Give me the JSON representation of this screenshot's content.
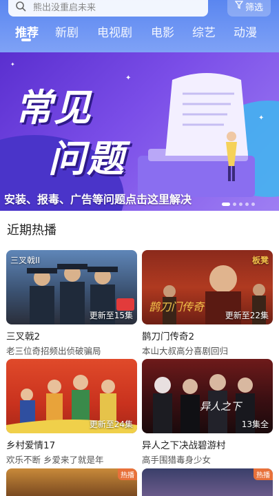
{
  "search": {
    "placeholder": "熊出没重启未来",
    "filter_label": "筛选"
  },
  "tabs": [
    {
      "label": "推荐",
      "active": true
    },
    {
      "label": "新剧",
      "active": false
    },
    {
      "label": "电视剧",
      "active": false
    },
    {
      "label": "电影",
      "active": false
    },
    {
      "label": "综艺",
      "active": false
    },
    {
      "label": "动漫",
      "active": false
    }
  ],
  "banner": {
    "title_line1": "常见",
    "title_line2": "问题",
    "caption": "安装、报毒、广告等问题点击这里解决"
  },
  "section": {
    "title": "近期热播"
  },
  "cards": [
    {
      "title": "三叉戟2",
      "subtitle": "老三位奇招频出侦破骗局",
      "badge": "更新至15集",
      "corner_text": "三叉戟II"
    },
    {
      "title": "鹊刀门传奇2",
      "subtitle": "本山大叔高分喜剧回归",
      "badge": "更新至22集",
      "corner_text": "鹊刀门传奇"
    },
    {
      "title": "乡村爱情17",
      "subtitle": "欢乐不断 乡爱来了就是年",
      "badge": "更新至24集",
      "corner_text": ""
    },
    {
      "title": "异人之下决战碧游村",
      "subtitle": "高手围猎毒身少女",
      "badge": "13集全",
      "corner_text": "异人之下"
    }
  ],
  "partial_cards": [
    {
      "tag": "热播"
    },
    {
      "tag": "热播"
    }
  ],
  "colors": {
    "header": "#5a86f0",
    "banner": "#6a3fe0",
    "badge_hot": "#e8713a"
  }
}
